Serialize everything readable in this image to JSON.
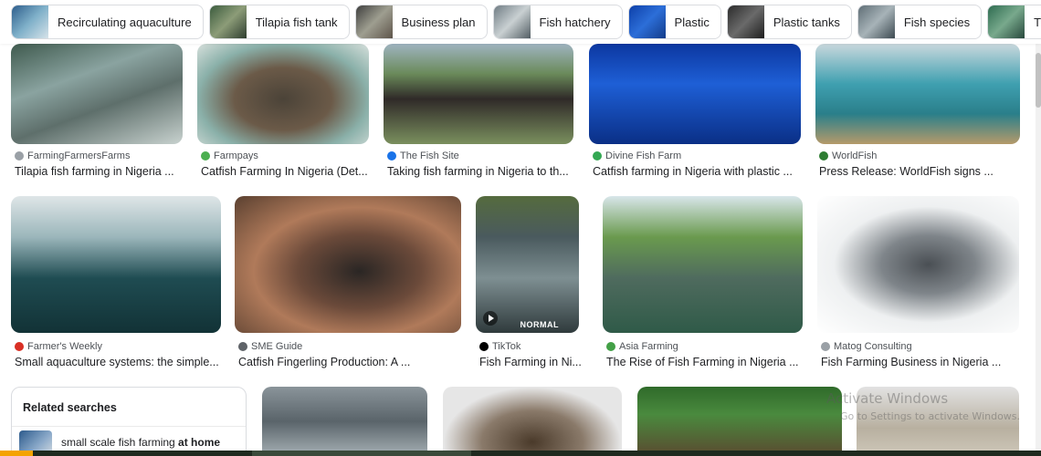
{
  "chips": [
    {
      "label": "Recirculating aquaculture",
      "thumb": "linear-gradient(135deg,#2b5b8a,#7fb0c9 50%,#d8e4ea)"
    },
    {
      "label": "Tilapia fish tank",
      "thumb": "linear-gradient(135deg,#395a3c,#8c9c78 50%,#2c3b2d)"
    },
    {
      "label": "Business plan",
      "thumb": "linear-gradient(135deg,#3c3c3c,#9e9e90 50%,#5c5248)"
    },
    {
      "label": "Fish hatchery",
      "thumb": "linear-gradient(135deg,#6d7a82,#c9d0d2 50%,#4f5a60)"
    },
    {
      "label": "Plastic",
      "thumb": "linear-gradient(135deg,#0d3fa8,#2c6ed8 50%,#123a88)"
    },
    {
      "label": "Plastic tanks",
      "thumb": "linear-gradient(135deg,#2a2a2a,#6a6a6a 50%,#1c1c1c)"
    },
    {
      "label": "Fish species",
      "thumb": "linear-gradient(135deg,#5d6c74,#a7b3b8 50%,#3a474e)"
    },
    {
      "label": "Tilapia",
      "thumb": "linear-gradient(135deg,#2c6a4f,#78a98c 50%,#25453a)"
    }
  ],
  "rows": [
    [
      {
        "source": "FarmingFarmersFarms",
        "title": "Tilapia fish farming in Nigeria ...",
        "fav": "#9aa0a6",
        "img": "linear-gradient(160deg,#3f5a4e 0%,#8aa3a0 35%,#5e6f6b 60%,#c8d2cf 100%)"
      },
      {
        "source": "Farmpays",
        "title": "Catfish Farming In Nigeria (Det...",
        "fav": "#4caf50",
        "img": "radial-gradient(ellipse at 50% 55%,#4b4338 0%,#6b5a48 40%,#8ab0a9 70%,#d7e0dc 100%)"
      },
      {
        "source": "The Fish Site",
        "title": "Taking fish farming in Nigeria to th...",
        "fav": "#1a73e8",
        "img": "linear-gradient(180deg,#9fb4c0 0%,#6a8a5a 30%,#2f2a28 55%,#7a8f5e 100%)"
      },
      {
        "source": "Divine Fish Farm",
        "title": "Catfish farming in Nigeria with plastic ...",
        "fav": "#34a853",
        "img": "linear-gradient(180deg,#0c37a0 0%,#1e5fd6 40%,#0a2f86 100%)"
      },
      {
        "source": "WorldFish",
        "title": "Press Release: WorldFish signs ...",
        "fav": "#2e7d32",
        "img": "linear-gradient(180deg,#c9d8dd 0%,#3fa0b0 40%,#2a7f8a 70%,#b59a6a 100%)"
      }
    ],
    [
      {
        "source": "Farmer's Weekly",
        "title": "Small aquaculture systems: the simple...",
        "fav": "#d93025",
        "img": "linear-gradient(180deg,#dfe6e8 0%,#9bb6bb 30%,#1f4c52 60%,#123236 100%)"
      },
      {
        "source": "SME Guide",
        "title": "Catfish Fingerling Production: A ...",
        "fav": "#5f6368",
        "img": "radial-gradient(ellipse at 55% 55%,#2a2624 0%,#6b4a3a 35%,#b07a5a 60%,#5a4030 100%)"
      },
      {
        "source": "TikTok",
        "title": "Fish Farming in Ni...",
        "fav": "#000000",
        "img": "linear-gradient(180deg,#556b3e 0%,#4a5a5e 30%,#7e8f92 60%,#2f3a3c 100%)"
      },
      {
        "source": "Asia Farming",
        "title": "The Rise of Fish Farming in Nigeria ...",
        "fav": "#43a047",
        "img": "linear-gradient(180deg,#d8e6ea 0%,#6a9a4e 30%,#4f6b5e 60%,#2f5a48 100%)"
      },
      {
        "source": "Matog Consulting",
        "title": "Fish Farming Business in Nigeria ...",
        "fav": "#9aa0a6",
        "img": "radial-gradient(ellipse at 55% 50%,#4a4f54 0%,#7f858a 30%,#eef0f1 60%,#ffffff 100%)"
      }
    ]
  ],
  "badge_normal": "NORMAL",
  "bottom_images": [
    "linear-gradient(180deg,#8a949a 0%,#5a646a 50%,#a6b0b5 100%)",
    "radial-gradient(ellipse at 50% 80%,#4a3a2a 0%,#8a7a6a 40%,#e6e6e6 70%)",
    "linear-gradient(180deg,#2f6a2a 0%,#4a8a3e 40%,#5a4a30 100%)",
    "linear-gradient(180deg,#e2e2e2 0%,#b8b0a0 60%,#cfc8ba 100%)"
  ],
  "related": {
    "heading": "Related searches",
    "item_prefix": "small scale fish farming ",
    "item_bold": "at home"
  },
  "watermark": {
    "line1": "Activate Windows",
    "line2": "Go to Settings to activate Windows."
  }
}
